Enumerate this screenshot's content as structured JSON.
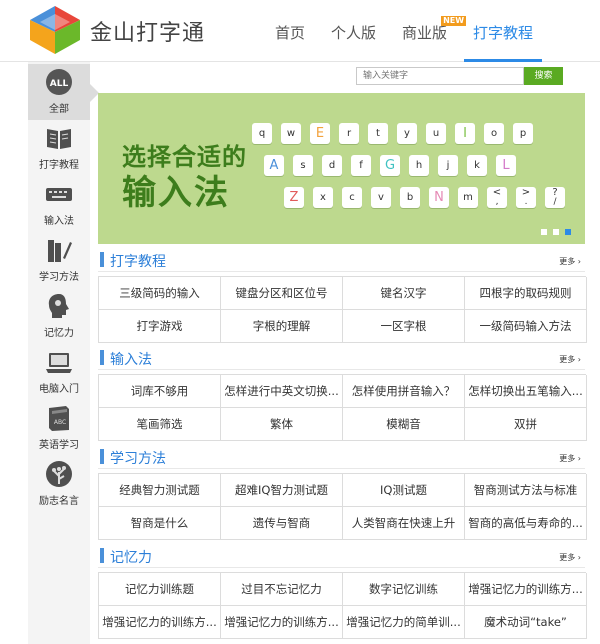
{
  "header": {
    "brand": "金山打字通",
    "nav": [
      {
        "label": "首页"
      },
      {
        "label": "个人版"
      },
      {
        "label": "商业版",
        "badge": "NEW"
      },
      {
        "label": "打字教程",
        "active": true
      }
    ]
  },
  "sidebar": {
    "items": [
      {
        "label": "全部",
        "icon": "all-icon",
        "icon_text": "ALL",
        "active": true
      },
      {
        "label": "打字教程",
        "icon": "book-icon"
      },
      {
        "label": "输入法",
        "icon": "keyboard-icon"
      },
      {
        "label": "学习方法",
        "icon": "books-pen-icon"
      },
      {
        "label": "记忆力",
        "icon": "brain-head-icon"
      },
      {
        "label": "电脑入门",
        "icon": "laptop-icon"
      },
      {
        "label": "英语学习",
        "icon": "abc-book-icon"
      },
      {
        "label": "励志名言",
        "icon": "tree-icon"
      }
    ]
  },
  "search": {
    "placeholder": "输入关键字",
    "button": "搜索"
  },
  "banner": {
    "line1": "选择合适的",
    "line2": "输入法",
    "rows": [
      [
        "q",
        "w",
        "E",
        "r",
        "t",
        "y",
        "u",
        "I",
        "o",
        "p"
      ],
      [
        "A",
        "s",
        "d",
        "f",
        "G",
        "h",
        "j",
        "k",
        "L"
      ],
      [
        "Z",
        "x",
        "c",
        "v",
        "b",
        "N",
        "m",
        "<",
        ">",
        "?"
      ]
    ],
    "row3_sub": [
      ",",
      ".",
      "/"
    ],
    "colored_keys": {
      "E": "#f2a23c",
      "I": "#7fc24a",
      "A": "#4a8fd9",
      "G": "#40c2c2",
      "L": "#d479c9",
      "Z": "#e25b5b",
      "N": "#e68ab5"
    },
    "slides": 3,
    "active_slide": 3
  },
  "more_label": "更多",
  "sections": [
    {
      "title": "打字教程",
      "items": [
        "三级简码的输入",
        "键盘分区和区位号",
        "键名汉字",
        "四根字的取码规则",
        "打字游戏",
        "字根的理解",
        "一区字根",
        "一级简码输入方法"
      ]
    },
    {
      "title": "输入法",
      "items": [
        "词库不够用",
        "怎样进行中英文切换...",
        "怎样使用拼音输入？",
        "怎样切换出五笔输入...",
        "笔画筛选",
        "繁体",
        "模糊音",
        "双拼"
      ]
    },
    {
      "title": "学习方法",
      "items": [
        "经典智力测试题",
        "超难IQ智力测试题",
        "IQ测试题",
        "智商测试方法与标准",
        "智商是什么",
        "遗传与智商",
        "人类智商在快速上升",
        "智商的高低与寿命的..."
      ]
    },
    {
      "title": "记忆力",
      "items": [
        "记忆力训练题",
        "过目不忘记忆力",
        "数字记忆训练",
        "增强记忆力的训练方...",
        "增强记忆力的训练方...",
        "增强记忆力的训练方...",
        "增强记忆力的简单训...",
        "魔术动词“take”"
      ]
    }
  ]
}
